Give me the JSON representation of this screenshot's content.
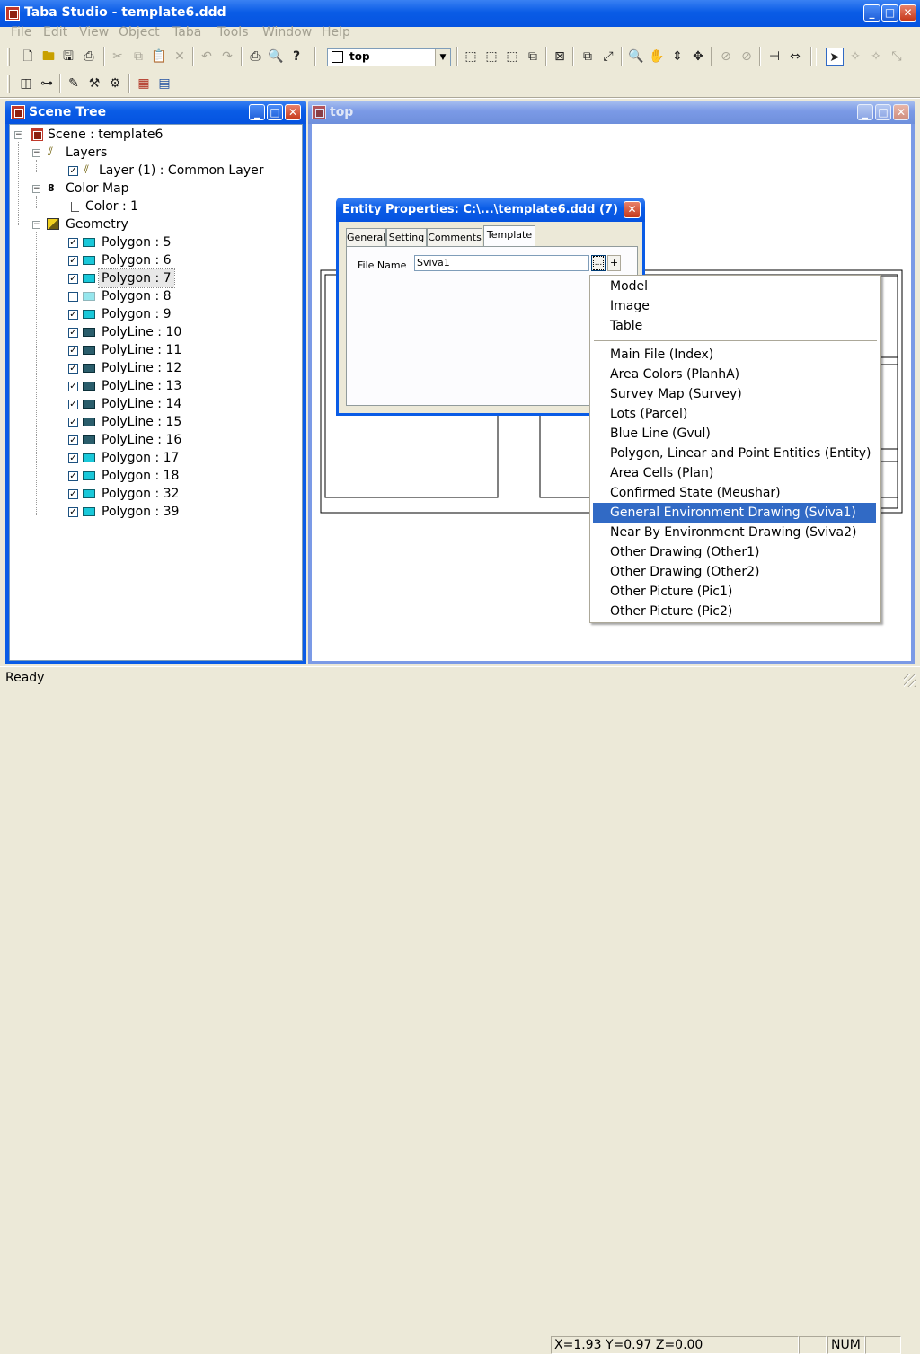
{
  "app": {
    "title": "Taba Studio - template6.ddd"
  },
  "menubar": [
    "File",
    "Edit",
    "View",
    "Object",
    "Taba",
    "Tools",
    "Window",
    "Help"
  ],
  "toolbar": {
    "view_select_value": "top"
  },
  "scene_tree": {
    "title": "Scene Tree",
    "scene_label": "Scene : template6",
    "layers_label": "Layers",
    "layer_item": "Layer (1) : Common Layer",
    "color_map_label": "Color Map",
    "color_item": "Color : 1",
    "geometry_label": "Geometry",
    "geometry_items": [
      {
        "label": "Polygon : 5",
        "kind": "polygon",
        "checked": true
      },
      {
        "label": "Polygon : 6",
        "kind": "polygon",
        "checked": true
      },
      {
        "label": "Polygon : 7",
        "kind": "polygon",
        "checked": true,
        "selected": true
      },
      {
        "label": "Polygon : 8",
        "kind": "polygon",
        "checked": false
      },
      {
        "label": "Polygon : 9",
        "kind": "polygon",
        "checked": true
      },
      {
        "label": "PolyLine : 10",
        "kind": "polyline",
        "checked": true
      },
      {
        "label": "PolyLine : 11",
        "kind": "polyline",
        "checked": true
      },
      {
        "label": "PolyLine : 12",
        "kind": "polyline",
        "checked": true
      },
      {
        "label": "PolyLine : 13",
        "kind": "polyline",
        "checked": true
      },
      {
        "label": "PolyLine : 14",
        "kind": "polyline",
        "checked": true
      },
      {
        "label": "PolyLine : 15",
        "kind": "polyline",
        "checked": true
      },
      {
        "label": "PolyLine : 16",
        "kind": "polyline",
        "checked": true
      },
      {
        "label": "Polygon : 17",
        "kind": "polygon",
        "checked": true
      },
      {
        "label": "Polygon : 18",
        "kind": "polygon",
        "checked": true
      },
      {
        "label": "Polygon : 32",
        "kind": "polygon",
        "checked": true
      },
      {
        "label": "Polygon : 39",
        "kind": "polygon",
        "checked": true
      }
    ]
  },
  "viewport": {
    "title": "top"
  },
  "dialog": {
    "title": "Entity Properties: C:\\...\\template6.ddd (7)",
    "tabs": [
      "General",
      "Setting",
      "Comments",
      "Template"
    ],
    "active_tab": "Template",
    "file_name_label": "File Name",
    "file_name_value": "Sviva1",
    "browse_label": "...",
    "add_label": "+"
  },
  "popup_menu": {
    "group1": [
      "Model",
      "Image",
      "Table"
    ],
    "group2": [
      "Main File (Index)",
      "Area Colors  (PlanhA)",
      "Survey Map (Survey)",
      "Lots (Parcel)",
      "Blue Line (Gvul)",
      "Polygon, Linear and Point Entities  (Entity)",
      "Area Cells  (Plan)",
      "Confirmed State (Meushar)",
      "General Environment Drawing (Sviva1)",
      "Near By Environment Drawing (Sviva2)",
      "Other Drawing (Other1)",
      "Other Drawing (Other2)",
      "Other Picture (Pic1)",
      "Other Picture (Pic2)"
    ],
    "selected": "General Environment Drawing (Sviva1)"
  },
  "statusbar": {
    "status": "Ready",
    "coords": "X=1.93 Y=0.97 Z=0.00",
    "num": "NUM"
  },
  "colors": {
    "titlebar": "#0a5ce6",
    "selection": "#316ac5",
    "polygon_icon": "#19c8d9",
    "polyline_icon": "#2a5d6b"
  }
}
